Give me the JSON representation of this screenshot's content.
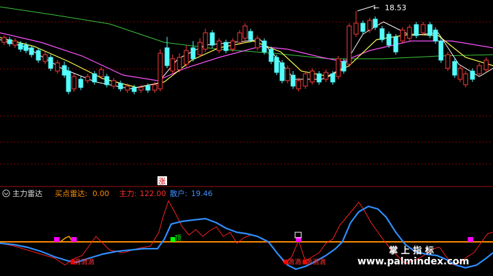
{
  "upper_panel": {
    "high_price_label": "18.53",
    "arrow_label": "←"
  },
  "limit_up_badge": "涨",
  "indicator_header": {
    "collapse_icon": "circle-chevron-icon",
    "name": "主力雷达",
    "buy_radar_label": "买点雷达:",
    "buy_radar_value": "0.00",
    "main_force_label": "主力:",
    "main_force_value": "122.00",
    "retail_label": "散户:",
    "retail_value": "19.46"
  },
  "signal_labels": {
    "top_label": "顶",
    "bottom_labels": [
      "滴滴滴",
      "滴滴",
      "滴滴滴"
    ]
  },
  "watermark": {
    "title": "掌 上 指 标",
    "url": "www.palmindex.com"
  },
  "colors": {
    "up_candle": "#ff3c3c",
    "down_candle": "#54fcfc",
    "ma5": "#ffffff",
    "ma10": "#ffff54",
    "ma20": "#ff54ff",
    "ma60": "#3cc83c",
    "main_force_line": "#ff2020",
    "retail_line": "#2f8fff",
    "zero_line": "#ff8c00",
    "signal_magenta": "#ff00ff",
    "header_orange": "#ff8c00",
    "header_red": "#ff3030",
    "header_blue": "#3f8fff"
  }
}
